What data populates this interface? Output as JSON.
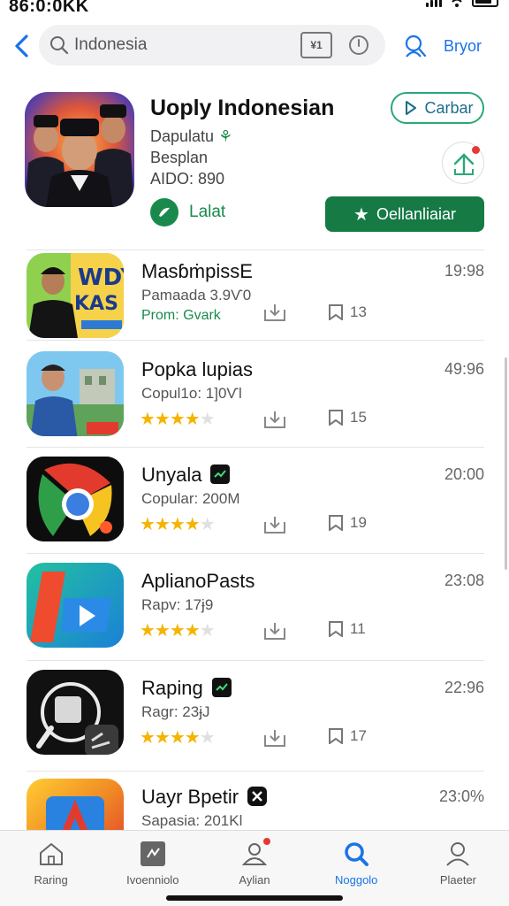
{
  "status": {
    "time": "86:0:0KK"
  },
  "search": {
    "value": "Indonesia",
    "kbd_label": "¥1",
    "right_label": "Bryor"
  },
  "feature": {
    "title": "Uoply Indonesian",
    "line1": "Dapulatu",
    "line1_mark": "⚘",
    "line2": "Besplan",
    "line3": "AIDO: 890",
    "outline_button": "Carbar",
    "secondary_label": "Lalat",
    "primary_button": "Oellanliaiar"
  },
  "apps": [
    {
      "name": "MasɓṁpissE",
      "sub": "Pamaada 3.9Ѵ0",
      "sub2": "Prom: Gvark",
      "time": "19:98",
      "count": "13",
      "rating": null
    },
    {
      "name": "Popka lupias",
      "sub": "Copul1o: 1]0Ѵl",
      "sub2": null,
      "time": "49:96",
      "count": "15",
      "rating": 4.5
    },
    {
      "name": "Unyala",
      "sub": "Copular: 200M",
      "sub2": null,
      "time": "20:00",
      "count": "19",
      "rating": 4.5,
      "badge": "green"
    },
    {
      "name": "AplianoPasts",
      "sub": "Rapv: 17ɉ9",
      "sub2": null,
      "time": "23:08",
      "count": "11",
      "rating": 4.5
    },
    {
      "name": "Raping",
      "sub": "Ragr: 23ɉJ",
      "sub2": null,
      "time": "22:96",
      "count": "17",
      "rating": 4.5,
      "badge": "green"
    },
    {
      "name": "Uayr Bpetir",
      "sub": "Sapasia: 201Kl",
      "sub2": null,
      "time": "23:0%",
      "count": "",
      "rating": null,
      "badge": "check"
    }
  ],
  "tabs": [
    {
      "label": "Raring",
      "icon": "home-icon"
    },
    {
      "label": "Ivoenniolo",
      "icon": "apps-icon"
    },
    {
      "label": "Aylian",
      "icon": "games-icon"
    },
    {
      "label": "Noggolo",
      "icon": "search-icon",
      "active": true
    },
    {
      "label": "Plaeter",
      "icon": "profile-icon"
    }
  ],
  "colors": {
    "accent": "#1a73e8",
    "green": "#167a45"
  }
}
